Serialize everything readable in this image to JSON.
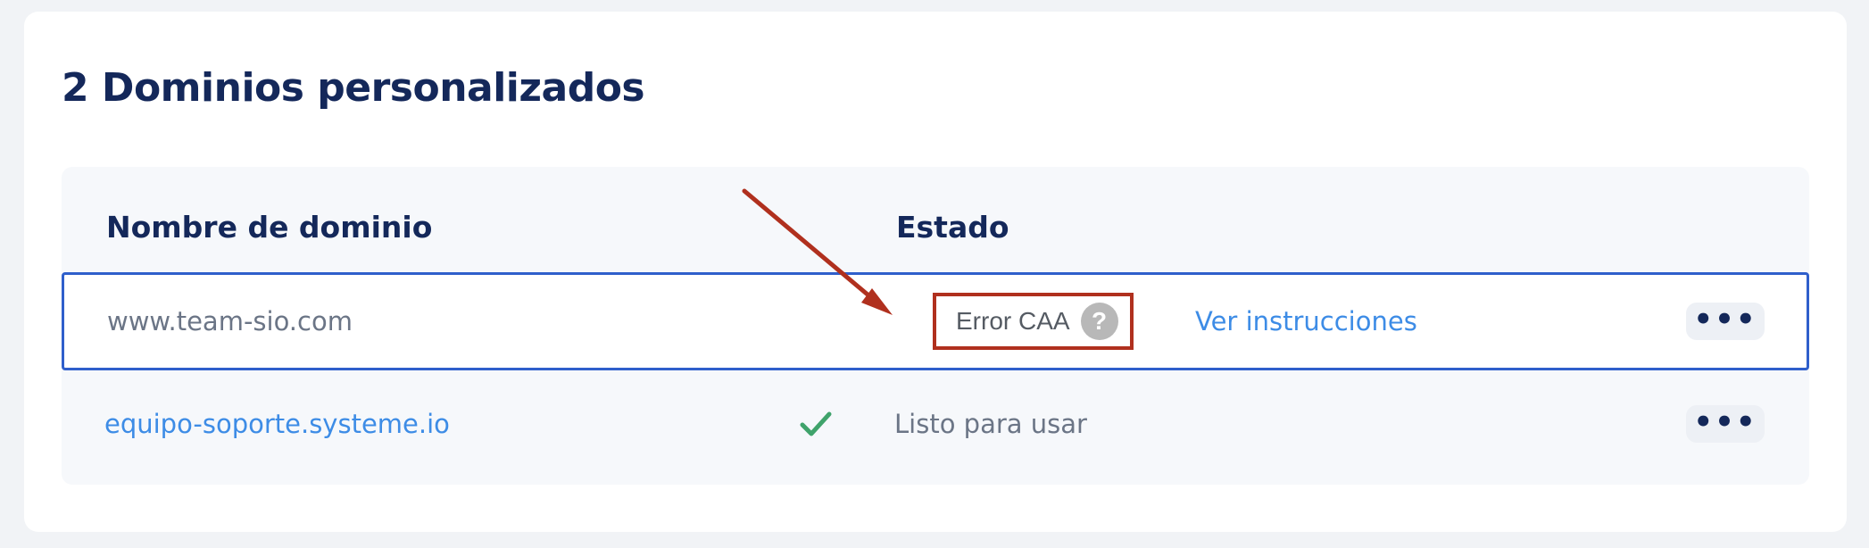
{
  "page": {
    "title": "2 Dominios personalizados"
  },
  "table": {
    "headers": {
      "domain": "Nombre de dominio",
      "status": "Estado"
    },
    "rows": [
      {
        "domain": "www.team-sio.com",
        "status": "Error CAA",
        "help_icon": "?",
        "instructions_link": "Ver instrucciones",
        "more_label": "•••",
        "verified": false
      },
      {
        "domain": "equipo-soporte.systeme.io",
        "status": "Listo para usar",
        "more_label": "•••",
        "verified": true
      }
    ]
  },
  "icons": {
    "check": "check-icon",
    "help": "question-circle-icon",
    "more": "more-horizontal-icon",
    "annotation": "arrow-icon"
  },
  "colors": {
    "title": "#14285a",
    "link": "#3d8ce6",
    "muted": "#6b7586",
    "success": "#3fa36b",
    "error_box": "#b0301e",
    "row_highlight": "#2f5fcb",
    "annotation_arrow": "#b0301e"
  }
}
